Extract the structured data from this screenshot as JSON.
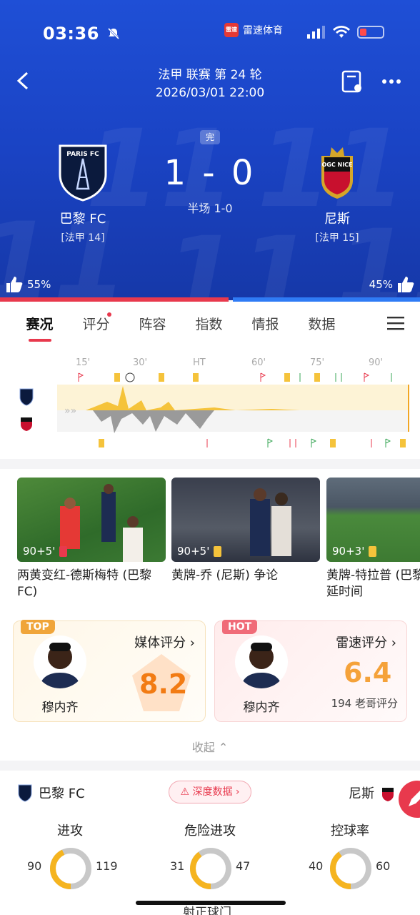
{
  "status_bar": {
    "time": "03:36",
    "app_name": "雷速体育",
    "app_logo_text": "雷速",
    "battery_color": "#ff4b4b"
  },
  "match": {
    "league_round": "法甲 联赛 第 24 轮",
    "datetime": "2026/03/01 22:00",
    "state": "完",
    "score": "1 - 0",
    "half_time": "半场 1-0",
    "home": {
      "name": "巴黎 FC",
      "rank": "[法甲 14]",
      "crest_text": "PARIS FC",
      "support": "55%"
    },
    "away": {
      "name": "尼斯",
      "rank": "[法甲 15]",
      "crest_text": "OGC NICE",
      "support": "45%"
    },
    "support_home_fraction": 0.55
  },
  "tabs": [
    {
      "label": "赛况",
      "active": true
    },
    {
      "label": "评分",
      "dot": true
    },
    {
      "label": "阵容"
    },
    {
      "label": "指数"
    },
    {
      "label": "情报"
    },
    {
      "label": "数据"
    }
  ],
  "timeline": {
    "ticks": [
      "15'",
      "30'",
      "HT",
      "60'",
      "75'",
      "90'"
    ]
  },
  "videos": [
    {
      "time": "90+5'",
      "card": "red",
      "title": "两黄变红-德斯梅特 (巴黎 FC)"
    },
    {
      "time": "90+5'",
      "card": "yellow",
      "title": "黄牌-乔 (尼斯) 争论"
    },
    {
      "time": "90+3'",
      "card": "yellow",
      "title": "黄牌-特拉普 (巴黎 FC) 拖延时间"
    }
  ],
  "ratings": {
    "media": {
      "badge": "TOP",
      "label": "媒体评分 ›",
      "player": "穆内齐",
      "value": "8.2"
    },
    "hot": {
      "badge": "HOT",
      "label": "雷速评分 ›",
      "player": "穆内齐",
      "value": "6.4",
      "sub": "194 老哥评分"
    },
    "collapse": "收起 ⌃"
  },
  "stats": {
    "home_name": "巴黎 FC",
    "away_name": "尼斯",
    "deep_button": "⚠ 深度数据 ›",
    "items": [
      {
        "label": "进攻",
        "home": "90",
        "away": "119"
      },
      {
        "label": "危险进攻",
        "home": "31",
        "away": "47"
      },
      {
        "label": "控球率",
        "home": "40",
        "away": "60"
      }
    ],
    "next_label": "射正球门"
  }
}
